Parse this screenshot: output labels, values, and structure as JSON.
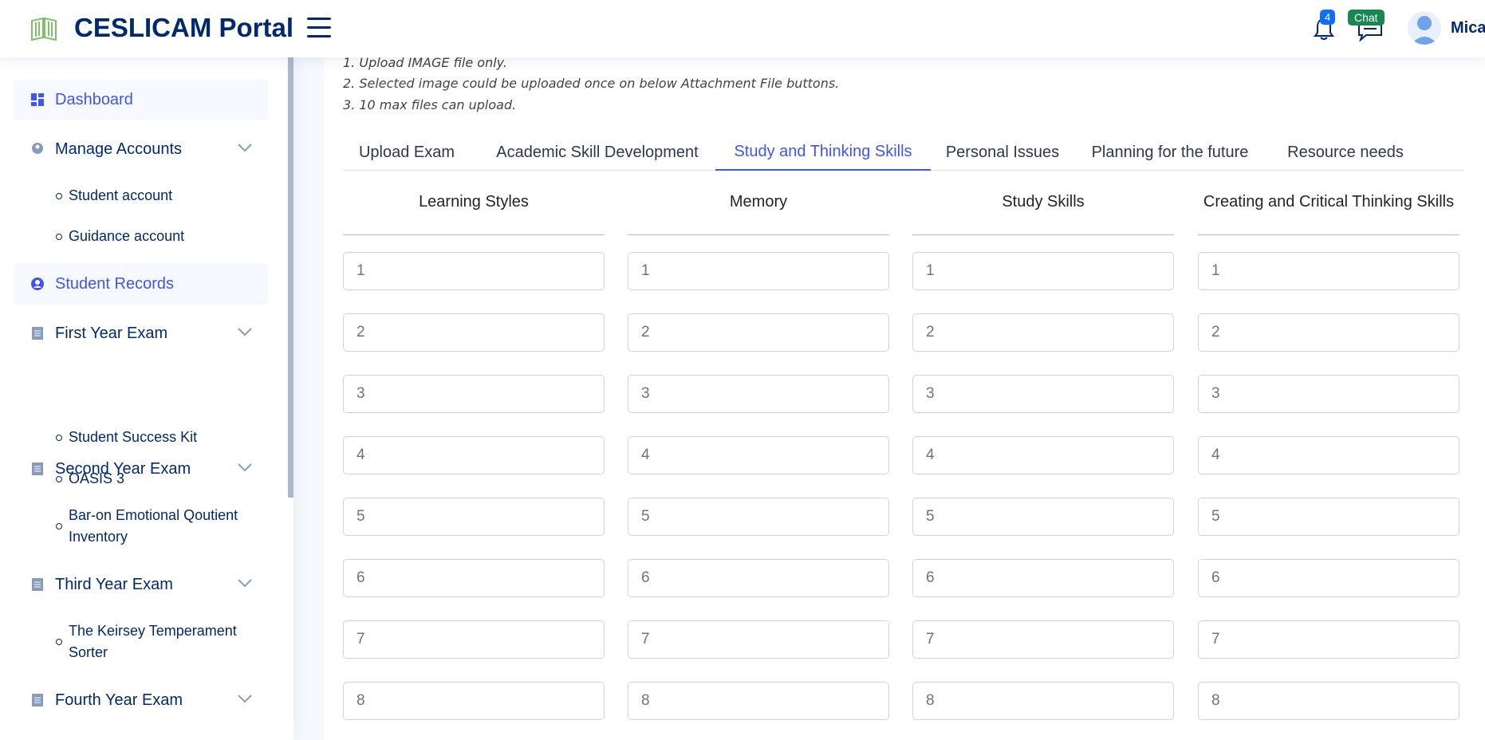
{
  "header": {
    "brand": "CESLICAM Portal",
    "notifications_count": "4",
    "chat_badge": "Chat",
    "user_name": "Mica",
    "icons": [
      "logo-book-icon",
      "hamburger-menu-icon",
      "bell-icon",
      "chat-icon",
      "avatar-icon"
    ]
  },
  "sidebar": {
    "items": [
      {
        "label": "Dashboard",
        "icon": "grid-icon",
        "active": true
      },
      {
        "label": "Manage Accounts",
        "icon": "users-icon",
        "expandable": true
      },
      {
        "label": "Student account"
      },
      {
        "label": "Guidance account"
      },
      {
        "label": "Student Records",
        "icon": "person-icon",
        "active": true
      },
      {
        "label": "First Year Exam",
        "icon": "document-icon",
        "expandable": true
      },
      {
        "label": "Student Success Kit"
      },
      {
        "label": "OASIS 3"
      },
      {
        "label": "Second Year Exam",
        "icon": "document-icon",
        "expandable": true
      },
      {
        "label": "Bar-on Emotional Qoutient Inventory"
      },
      {
        "label": "Third Year Exam",
        "icon": "document-icon",
        "expandable": true
      },
      {
        "label": "The Keirsey Temperament Sorter"
      },
      {
        "label": "Fourth Year Exam",
        "icon": "document-icon",
        "expandable": true
      }
    ]
  },
  "main": {
    "notes": [
      "1. Upload IMAGE file only.",
      "2. Selected image could be uploaded once on below Attachment File buttons.",
      "3. 10 max files can upload."
    ],
    "tabs": [
      {
        "label": "Upload Exam"
      },
      {
        "label": "Academic Skill Development"
      },
      {
        "label": "Study and Thinking Skills",
        "active": true
      },
      {
        "label": "Personal Issues"
      },
      {
        "label": "Planning for the future"
      },
      {
        "label": "Resource needs"
      }
    ],
    "columns": [
      {
        "title": "Learning Styles",
        "placeholders": [
          "1",
          "2",
          "3",
          "4",
          "5",
          "6",
          "7",
          "8"
        ]
      },
      {
        "title": "Memory",
        "placeholders": [
          "1",
          "2",
          "3",
          "4",
          "5",
          "6",
          "7",
          "8"
        ]
      },
      {
        "title": "Study Skills",
        "placeholders": [
          "1",
          "2",
          "3",
          "4",
          "5",
          "6",
          "7",
          "8"
        ]
      },
      {
        "title": "Creating and Critical Thinking Skills",
        "placeholders": [
          "1",
          "2",
          "3",
          "4",
          "5",
          "6",
          "7",
          "8"
        ]
      }
    ]
  },
  "colors": {
    "primary": "#4154f1",
    "navy": "#012970",
    "bell_badge": "#0d6efd",
    "chat_badge": "#198754"
  }
}
